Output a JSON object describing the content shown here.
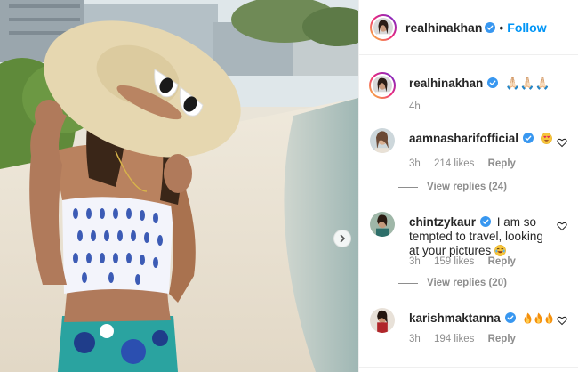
{
  "post": {
    "author": "realhinakhan",
    "follow_label": "Follow",
    "dot": "•",
    "caption_emoji": "🙏🏻🙏🏻🙏🏻",
    "caption_time": "4h"
  },
  "comments": [
    {
      "username": "aamnasharifofficial",
      "text": "",
      "emoji": "heart-eyes",
      "time": "3h",
      "likes": "214 likes",
      "reply_label": "Reply",
      "view_replies": "View replies (24)"
    },
    {
      "username": "chintzykaur",
      "text": "I am so tempted to travel, looking at your pictures",
      "emoji": "laughing",
      "time": "3h",
      "likes": "159 likes",
      "reply_label": "Reply",
      "view_replies": "View replies (20)"
    },
    {
      "username": "karishmaktanna",
      "text": "",
      "emoji": "fire-x3",
      "time": "3h",
      "likes": "194 likes",
      "reply_label": "Reply"
    }
  ],
  "colors": {
    "accent": "#0095f6",
    "verified": "#3897f0",
    "muted": "#8e8e8e"
  },
  "icons": {
    "next": "chevron-right-icon",
    "like": "heart-outline-icon",
    "verified": "verified-badge-icon"
  }
}
